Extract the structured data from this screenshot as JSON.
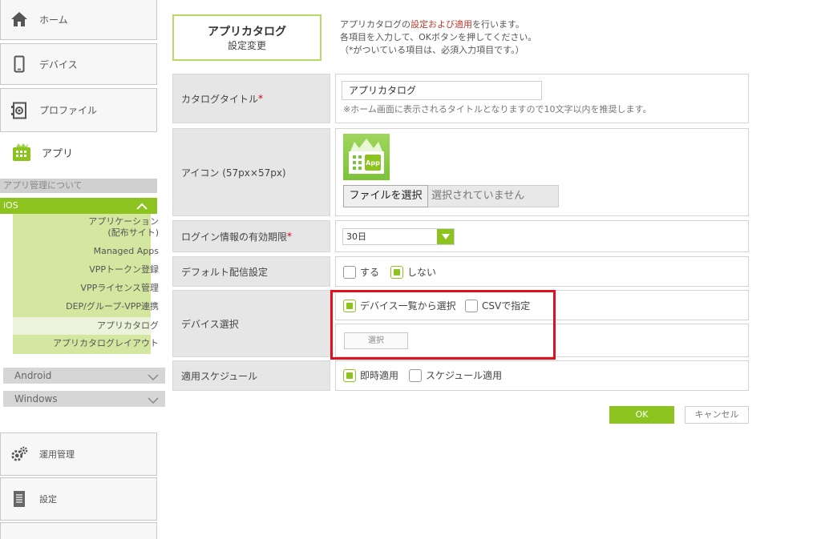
{
  "sidebar": {
    "home_label": "ホーム",
    "device_label": "デバイス",
    "profile_label": "プロファイル",
    "app_label": "アプリ",
    "about_label": "アプリ管理について",
    "ios_label": "iOS",
    "ios_items": [
      "アプリケーション",
      "(配布サイト)",
      "Managed Apps",
      "VPPトークン登録",
      "VPPライセンス管理",
      "DEP/グループ-VPP連携",
      "アプリカタログ",
      "アプリカタログレイアウト"
    ],
    "android_label": "Android",
    "windows_label": "Windows",
    "ops_label": "運用管理",
    "settings_label": "設定"
  },
  "header": {
    "title_line1": "アプリカタログ",
    "title_line2": "設定変更",
    "desc_pre": "アプリカタログの",
    "desc_red": "設定および適用",
    "desc_post": "を行います。",
    "desc_line2": "各項目を入力して、OKボタンを押してください。",
    "desc_line3": "（*がついている項目は、必須入力項目です。）"
  },
  "form": {
    "catalog_title_label": "カタログタイトル",
    "required_mark": "*",
    "catalog_title_value": "アプリカタログ",
    "catalog_title_note": "※ホーム画面に表示されるタイトルとなりますので10文字以内を推奨します。",
    "icon_label": "アイコン (57px×57px)",
    "icon_app_text": "App",
    "file_button": "ファイルを選択",
    "file_status": "選択されていません",
    "login_label": "ログイン情報の有効期限",
    "login_value": "30日",
    "default_label": "デフォルト配信設定",
    "default_yes": "する",
    "default_no": "しない",
    "device_label": "デバイス選択",
    "device_opt_list": "デバイス一覧から選択",
    "device_opt_csv": "CSVで指定",
    "select_button": "選択",
    "schedule_label": "適用スケジュール",
    "schedule_now": "即時適用",
    "schedule_later": "スケジュール適用"
  },
  "actions": {
    "ok": "OK",
    "cancel": "キャンセル"
  },
  "colors": {
    "accent": "#8cc31e",
    "highlight": "#e0101e"
  }
}
